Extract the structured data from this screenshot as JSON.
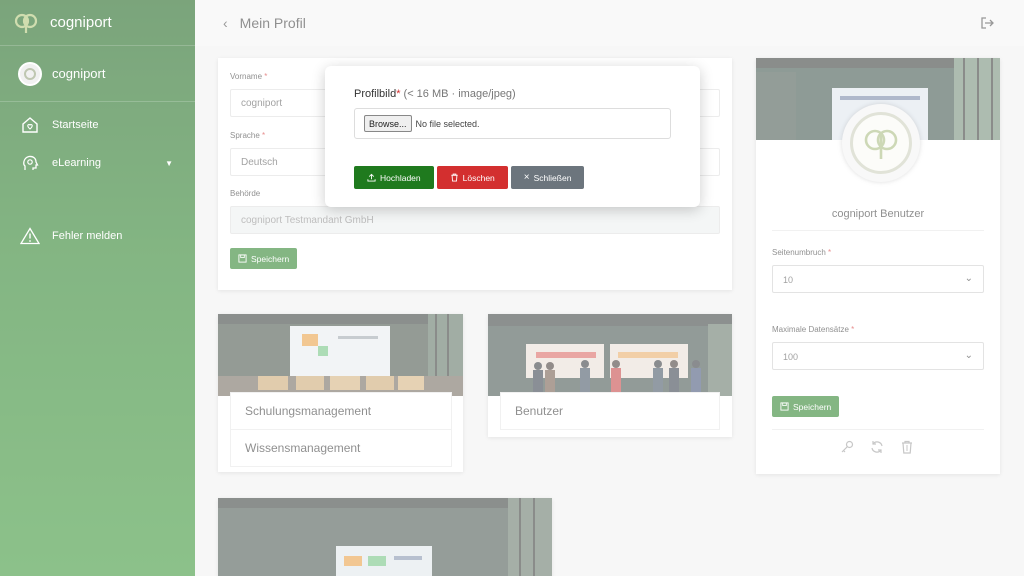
{
  "app": {
    "name": "cogniport"
  },
  "sidebar": {
    "user_name": "cogniport",
    "items": [
      {
        "label": "Startseite",
        "icon": "home-heart-icon"
      },
      {
        "label": "eLearning",
        "icon": "head-gear-icon"
      },
      {
        "label": "Fehler melden",
        "icon": "warning-icon"
      }
    ]
  },
  "header": {
    "title": "Mein Profil"
  },
  "form": {
    "vorname_label": "Vorname",
    "vorname_value": "cogniport",
    "sprache_label": "Sprache",
    "sprache_value": "Deutsch",
    "behoerde_label": "Behörde",
    "behoerde_value": "cogniport Testmandant GmbH",
    "save_label": "Speichern",
    "required_mark": "*"
  },
  "tiles": [
    {
      "items": [
        "Schulungsmanagement",
        "Wissensmanagement"
      ]
    },
    {
      "items": [
        "Benutzer"
      ]
    }
  ],
  "profile": {
    "name": "cogniport Benutzer",
    "page_size_label": "Seitenumbruch",
    "page_size_value": "10",
    "max_records_label": "Maximale Datensätze",
    "max_records_value": "100",
    "save_label": "Speichern"
  },
  "modal": {
    "label": "Profilbild",
    "required_mark": "*",
    "hint": "(< 16 MB · image/jpeg)",
    "browse_label": "Browse...",
    "file_status": "No file selected.",
    "upload_label": "Hochladen",
    "delete_label": "Löschen",
    "close_label": "Schließen"
  },
  "colors": {
    "brand_green": "#1f7a1e",
    "danger": "#d32f2f",
    "secondary": "#6c757d"
  }
}
